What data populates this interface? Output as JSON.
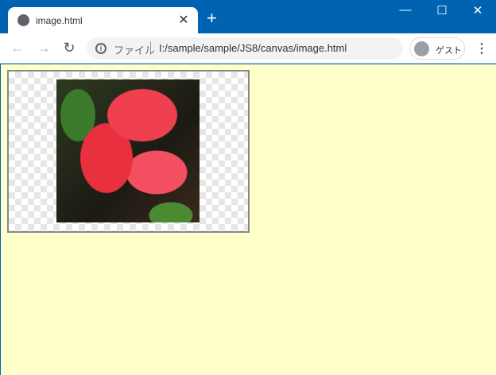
{
  "tab": {
    "title": "image.html",
    "close": "✕",
    "new_tab": "+"
  },
  "window": {
    "minimize": "—",
    "maximize": "☐",
    "close": "✕"
  },
  "toolbar": {
    "back": "←",
    "forward": "→",
    "reload": "↻",
    "info": "i",
    "scheme_label": "ファイル",
    "url": "I:/sample/sample/JS8/canvas/image.html",
    "profile": "ゲスト",
    "menu": "⋮"
  }
}
